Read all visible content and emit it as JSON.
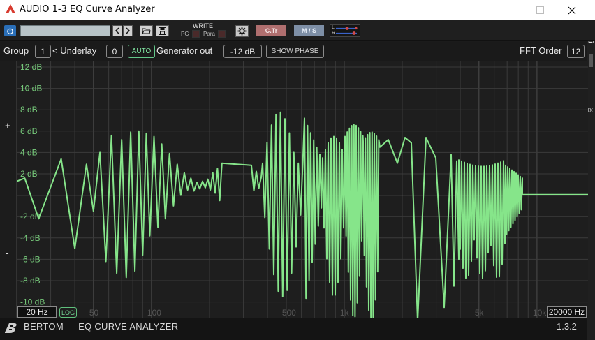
{
  "window": {
    "title": "AUDIO 1-3 EQ Curve Analyzer",
    "icons": {
      "app": "app-logo-icon",
      "minimize": "minimize-icon",
      "maximize": "maximize-icon",
      "close": "close-icon"
    }
  },
  "host_toolbar": {
    "preset_value": "",
    "write_label": "WRITE",
    "pg_label": "PG",
    "para_label": "Para",
    "ctr_label": "C.Tr",
    "ms_label": "M / S",
    "route_l": "L",
    "route_r": "R",
    "colors": {
      "power": "#2a6fb8",
      "ctr": "#b06f6f",
      "ms": "#7e8fa6"
    },
    "icons": {
      "power": "power-icon",
      "prev": "chevron-left-icon",
      "next": "chevron-right-icon",
      "open": "folder-open-icon",
      "save": "floppy-disk-icon",
      "settings": "gear-icon"
    }
  },
  "controls": {
    "group_label": "Group",
    "group_value": "1",
    "underlay_label": "< Underlay",
    "underlay_value": "0",
    "auto_label": "AUTO",
    "generator_label": "Generator out",
    "generator_value": "-12 dB",
    "show_phase_label": "SHOW PHASE",
    "fft_label": "FFT Order",
    "fft_value": "12"
  },
  "side": {
    "plus": "+",
    "minus": "-",
    "right_edge_texts": [
      "ER",
      "IX"
    ]
  },
  "plot": {
    "db_labels": [
      "12 dB",
      "10 dB",
      "8 dB",
      "6 dB",
      "4 dB",
      "2 dB",
      "-2 dB",
      "-4 dB",
      "-6 dB",
      "-8 dB",
      "-10 dB"
    ],
    "freq_labels": [
      "50",
      "100",
      "500",
      "1k",
      "5k",
      "10k"
    ],
    "min_freq": "20 Hz",
    "max_freq": "20000 Hz",
    "log_label": "LOG",
    "colors": {
      "curve": "#86e58a",
      "grid_minor": "#3b3b3b",
      "grid_major": "#4d4d4d",
      "db_label": "#76c97a",
      "zero_line": "#8a8a8a"
    }
  },
  "footer": {
    "brand": "BERTOM — EQ CURVE ANALYZER",
    "version": "1.3.2",
    "logo_icon": "bertom-logo-icon"
  },
  "chart_data": {
    "type": "line",
    "title": "",
    "xlabel": "",
    "ylabel": "",
    "x_scale": "log",
    "xlim": [
      20,
      20000
    ],
    "ylim": [
      -12,
      12
    ],
    "x_ticks": [
      50,
      100,
      500,
      1000,
      5000,
      10000
    ],
    "y_ticks": [
      12,
      10,
      8,
      6,
      4,
      2,
      -2,
      -4,
      -6,
      -8,
      -10
    ],
    "grid": true,
    "series": [
      {
        "x": [
          20,
          22,
          26,
          34,
          40,
          46,
          50,
          54,
          58,
          62,
          66,
          70,
          74,
          78,
          82,
          86,
          90,
          94,
          98,
          103,
          108,
          113,
          118,
          124,
          130,
          136,
          142,
          148,
          154,
          160,
          166,
          172,
          178,
          184,
          190,
          196,
          202,
          208,
          214,
          220,
          226,
          232
        ],
        "y": [
          1.3,
          1.6,
          -2.2,
          3.4,
          -5.0,
          2.9,
          -1.5,
          4.0,
          -6.2,
          5.6,
          -7.3,
          5.2,
          -7.7,
          5.9,
          -7.1,
          6.0,
          -5.6,
          5.8,
          -3.8,
          5.5,
          -3.0,
          4.8,
          -2.2,
          3.9,
          -1.0,
          2.9,
          0.0,
          2.1,
          0.5,
          1.6,
          0.4,
          1.2,
          0.6,
          1.3,
          0.7,
          1.5,
          0.5,
          2.1,
          0.2,
          2.5,
          -0.5,
          3.0
        ]
      }
    ]
  }
}
